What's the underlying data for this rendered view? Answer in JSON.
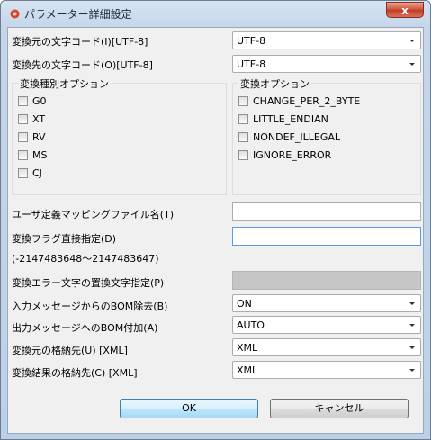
{
  "window": {
    "title": "パラメーター詳細設定",
    "close_label": "x"
  },
  "fields": {
    "src_code": {
      "label": "変換元の文字コード(I)[UTF-8]",
      "value": "UTF-8"
    },
    "dst_code": {
      "label": "変換先の文字コード(O)[UTF-8]",
      "value": "UTF-8"
    }
  },
  "conv_type_group": {
    "title": "変換種別オプション",
    "items": [
      "G0",
      "XT",
      "RV",
      "MS",
      "CJ"
    ]
  },
  "conv_opt_group": {
    "title": "変換オプション",
    "items": [
      "CHANGE_PER_2_BYTE",
      "LITTLE_ENDIAN",
      "NONDEF_ILLEGAL",
      "IGNORE_ERROR"
    ]
  },
  "user_mapping": {
    "label": "ユーザ定義マッピングファイル名(T)",
    "value": ""
  },
  "conv_flag": {
    "label": "変換フラグ直接指定(D)",
    "value": "",
    "range": "(-2147483648〜2147483647)"
  },
  "replace_char": {
    "label": "変換エラー文字の置換文字指定(P)",
    "value": ""
  },
  "bom_remove": {
    "label": "入力メッセージからのBOM除去(B)",
    "value": "ON"
  },
  "bom_add": {
    "label": "出力メッセージへのBOM付加(A)",
    "value": "AUTO"
  },
  "src_store": {
    "label": "変換元の格納先(U) [XML]",
    "value": "XML"
  },
  "dst_store": {
    "label": "変換結果の格納先(C) [XML]",
    "value": "XML"
  },
  "buttons": {
    "ok": "OK",
    "cancel": "キャンセル"
  }
}
